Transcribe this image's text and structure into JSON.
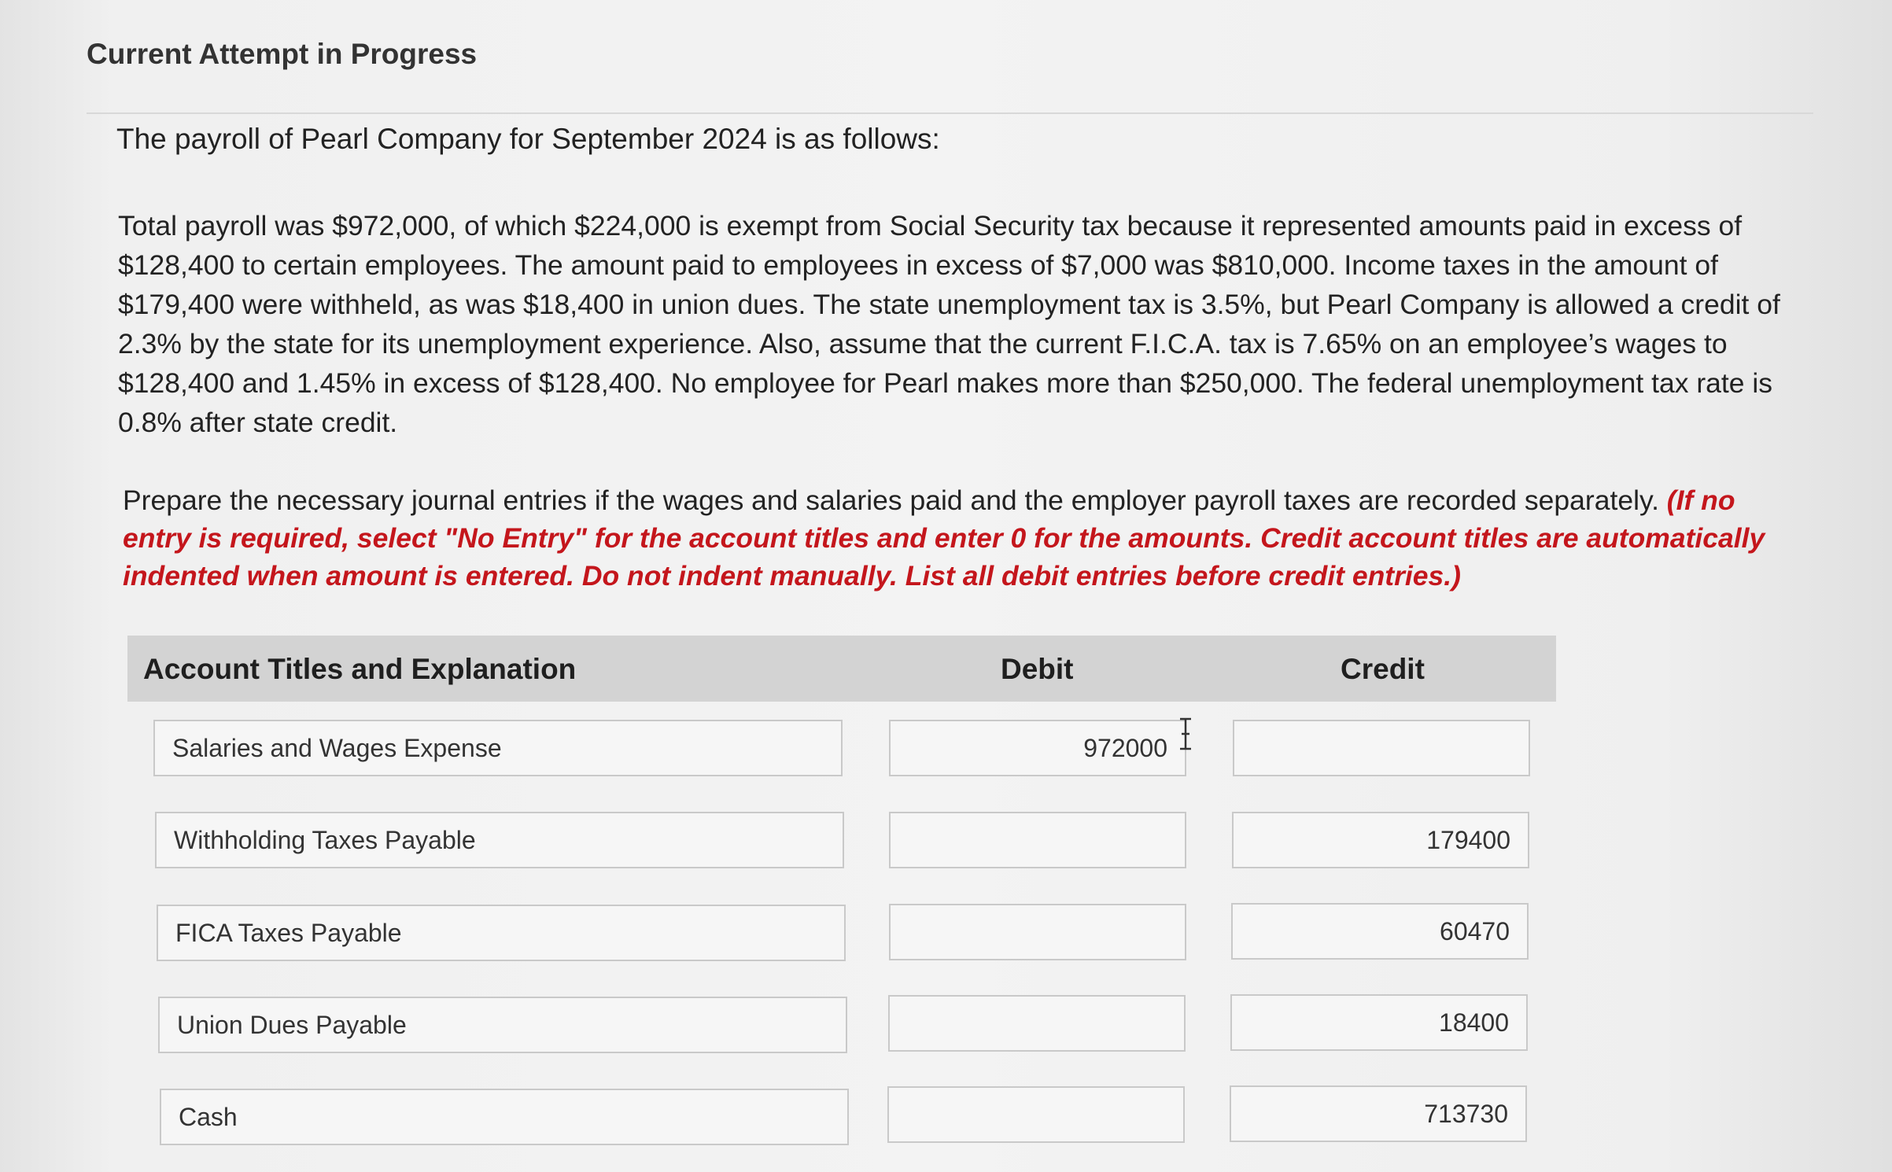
{
  "header": {
    "attempt_title": "Current Attempt in Progress"
  },
  "question": {
    "intro": "The payroll of Pearl Company for September 2024 is as follows:",
    "problem_text": "Total payroll was $972,000, of which $224,000 is exempt from Social Security tax because it represented amounts paid in excess of $128,400 to certain employees. The amount paid to employees in excess of $7,000 was $810,000. Income taxes in the amount of $179,400 were withheld, as was $18,400 in union dues. The state unemployment tax is 3.5%, but Pearl Company is allowed a credit of 2.3% by the state for its unemployment experience. Also, assume that the current F.I.C.A. tax is 7.65% on an employee’s wages to $128,400 and 1.45% in excess of $128,400. No employee for Pearl makes more than $250,000. The federal unemployment tax rate is 0.8% after state credit.",
    "instruction_text": "Prepare the necessary journal entries if the wages and salaries paid and the employer payroll taxes are recorded separately. ",
    "instruction_note": "(If no entry is required, select \"No Entry\" for the account titles and enter 0 for the amounts. Credit account titles are automatically indented when amount is entered. Do not indent manually. List all debit entries before credit entries.)"
  },
  "table": {
    "headers": {
      "account": "Account Titles and Explanation",
      "debit": "Debit",
      "credit": "Credit"
    },
    "rows": [
      {
        "account": "Salaries and Wages Expense",
        "debit": "972000",
        "credit": ""
      },
      {
        "account": "Withholding Taxes Payable",
        "debit": "",
        "credit": "179400"
      },
      {
        "account": "FICA Taxes Payable",
        "debit": "",
        "credit": "60470"
      },
      {
        "account": "Union Dues Payable",
        "debit": "",
        "credit": "18400"
      },
      {
        "account": "Cash",
        "debit": "",
        "credit": "713730"
      }
    ]
  },
  "icons": {
    "cursor": "text-cursor-icon"
  }
}
